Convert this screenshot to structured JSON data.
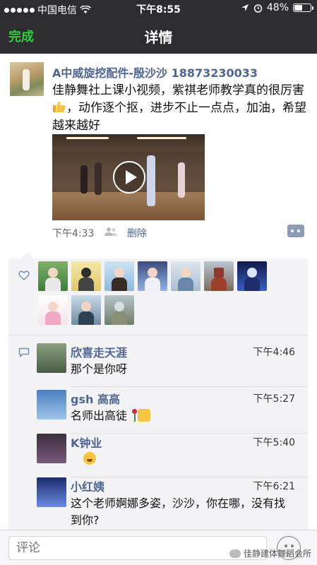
{
  "status_bar": {
    "carrier": "中国电信",
    "time": "下午8:55",
    "battery_percent": "48%",
    "battery_level": 0.48
  },
  "nav": {
    "done_label": "完成",
    "title": "详情"
  },
  "post": {
    "author": "A中威旋挖配件-殷沙沙 18873230033",
    "text_before_emoji": "佳静舞社上课小视频，紫祺老师教学真的很厉害",
    "text_after_emoji": "，动作逐个抠，进步不止一点点，加油，希望越来越好",
    "time": "下午4:33",
    "delete_label": "删除",
    "icons": {
      "people": "people-icon",
      "comment": "comment-more-icon",
      "play": "play-icon"
    }
  },
  "likes": {
    "icon": "heart-icon",
    "count": 11
  },
  "comments": [
    {
      "name": "欣喜走天涯",
      "time": "下午4:46",
      "text": "那个是你呀"
    },
    {
      "name": "gsh 高高",
      "time": "下午5:27",
      "text": "名师出高徒"
    },
    {
      "name": "K钟业",
      "time": "下午5:40",
      "text": ""
    },
    {
      "name": "小红姨",
      "time": "下午6:21",
      "text": "这个老师婀娜多姿，沙沙，你在哪，没有找到你?"
    }
  ],
  "input": {
    "placeholder": "评论"
  },
  "watermark": "佳静建体舞蹈会所",
  "colors": {
    "nav_bg": "#2c2c31",
    "done_green": "#2fce3c",
    "name_blue": "#4f6592",
    "panel_bg": "#f3f3f5"
  }
}
